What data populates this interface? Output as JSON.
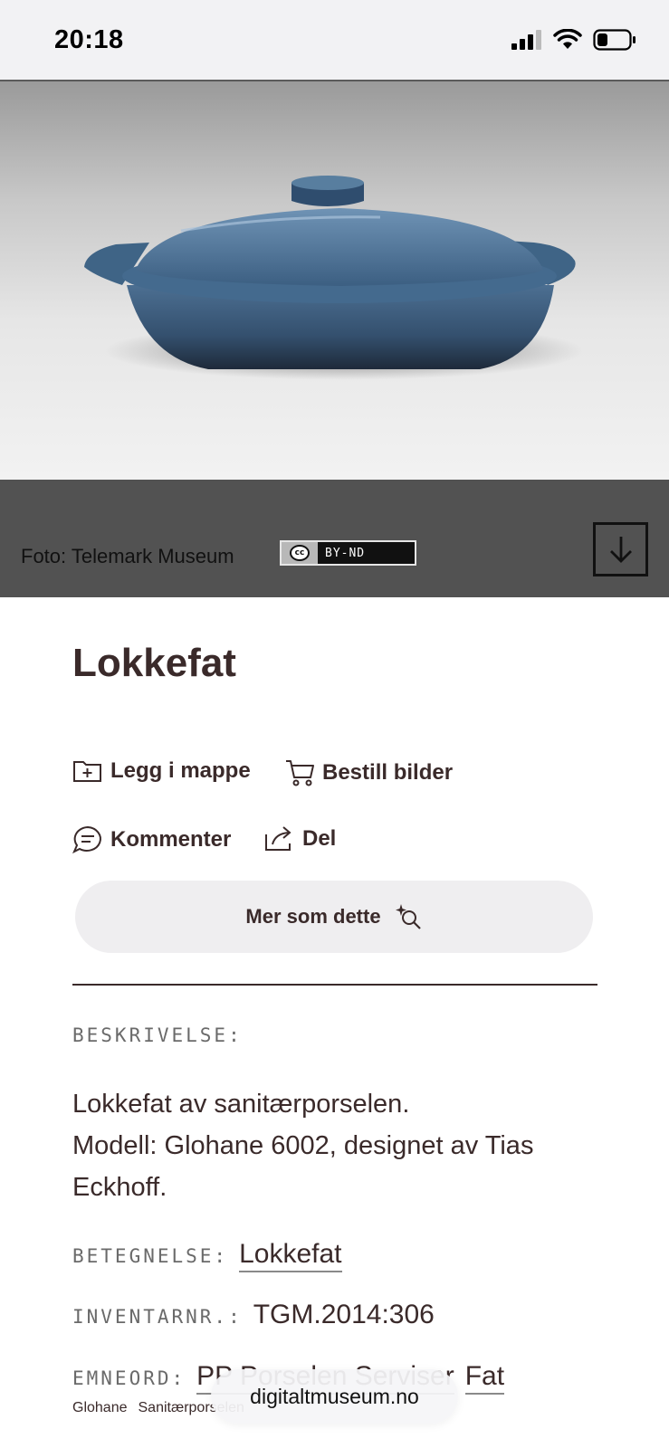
{
  "status_bar": {
    "time": "20:18"
  },
  "hero": {
    "caption": "Foto: Telemark Museum",
    "license": "BY-ND",
    "license_symbol": "cc"
  },
  "object": {
    "title": "Lokkefat"
  },
  "actions": {
    "add_to_folder": "Legg i mappe",
    "order_images": "Bestill bilder",
    "comment": "Kommenter",
    "share": "Del",
    "more_like_this": "Mer som dette"
  },
  "details": {
    "description_label": "BESKRIVELSE:",
    "description_lines": [
      "Lokkefat av sanitærporselen.",
      "Modell: Glohane 6002, designet av Tias",
      "Eckhoff."
    ],
    "designation_label": "BETEGNELSE:",
    "designation_value": "Lokkefat",
    "inventory_label": "INVENTARNR.:",
    "inventory_value": "TGM.2014:306",
    "keywords_label": "EMNEORD:",
    "keywords": [
      "PP Porselen Serviser",
      "Fat",
      "Glohane",
      "Sanitærporselen"
    ]
  },
  "browser": {
    "url": "digitaltmuseum.no"
  },
  "colors": {
    "text": "#3a2a2a",
    "caption_bar": "#525252",
    "dish_blue": "#3f6486"
  }
}
